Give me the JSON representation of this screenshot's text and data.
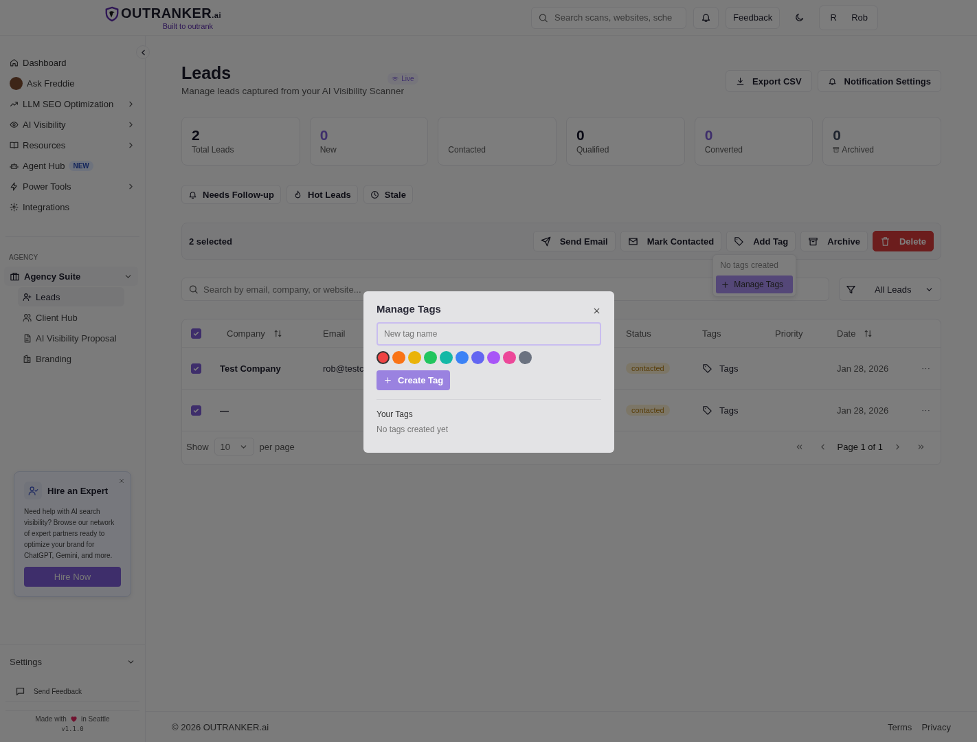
{
  "header": {
    "logo": {
      "name": "OUTRANKER",
      "suffix": ".ai",
      "tagline": "Built to outrank"
    },
    "search": {
      "placeholder": "Search scans, websites, sche"
    },
    "feedback": "Feedback",
    "user": {
      "initial": "R",
      "name": "Rob"
    }
  },
  "sidebar": {
    "nav": [
      {
        "label": "Dashboard",
        "chevron": false
      },
      {
        "label": "Ask Freddie",
        "chevron": false
      },
      {
        "label": "LLM SEO Optimization",
        "chevron": true
      },
      {
        "label": "AI Visibility",
        "chevron": true
      },
      {
        "label": "Resources",
        "chevron": true
      },
      {
        "label": "Agent Hub",
        "chevron": false,
        "badge": "NEW"
      },
      {
        "label": "Power Tools",
        "chevron": true
      },
      {
        "label": "Integrations",
        "chevron": false
      }
    ],
    "section_label": "AGENCY",
    "group": {
      "label": "Agency Suite",
      "expanded": true,
      "children": [
        {
          "label": "Leads",
          "selected": true
        },
        {
          "label": "Client Hub",
          "selected": false
        },
        {
          "label": "AI Visibility Proposal",
          "selected": false
        },
        {
          "label": "Branding",
          "selected": false
        }
      ]
    },
    "promo": {
      "title": "Hire an Expert",
      "text": "Need help with AI search visibility? Browse our network of expert partners ready to optimize your brand for ChatGPT, Gemini, and more.",
      "button": "Hire Now"
    },
    "settings": {
      "label": "Settings",
      "expanded": false
    },
    "send_feedback": "Send Feedback",
    "made_with": {
      "before": "Made with",
      "after": "in Seattle",
      "version": "v1.1.0"
    }
  },
  "main": {
    "title": "Leads",
    "live": "Live",
    "subtitle": "Manage leads captured from your AI Visibility Scanner",
    "actions": [
      "Export CSV",
      "Notification Settings"
    ],
    "stats": [
      {
        "value": "2",
        "label": "Total Leads",
        "kind": "dark"
      },
      {
        "value": "0",
        "label": "New",
        "kind": "accent"
      },
      {
        "label": "Contacted"
      },
      {
        "value": "0",
        "label": "Qualified",
        "kind": "dark"
      },
      {
        "value": "0",
        "label": "Converted",
        "kind": "accent"
      },
      {
        "value": "0",
        "label": "Archived",
        "kind": "muted"
      }
    ],
    "quick_filters": [
      "Needs Follow-up",
      "Hot Leads",
      "Stale"
    ],
    "bulk_bar": {
      "count": "2 selected",
      "actions": [
        {
          "label": "Send Email",
          "kind": "plain"
        },
        {
          "label": "Mark Contacted",
          "kind": "plain"
        },
        {
          "label": "Add Tag",
          "kind": "plain"
        },
        {
          "label": "Archive",
          "kind": "plain"
        },
        {
          "label": "Delete",
          "kind": "danger"
        }
      ]
    },
    "tag_menu": {
      "empty": "No tags created",
      "button": "Manage Tags"
    },
    "search": {
      "placeholder": "Search by email, company, or website..."
    },
    "filter": "All Leads",
    "table": {
      "all_selected": true,
      "columns": [
        {
          "label": "Company",
          "sortable": true
        },
        {
          "label": "Email",
          "sortable": false
        },
        {
          "label": "Status",
          "sortable": false
        },
        {
          "label": "Tags",
          "sortable": false
        },
        {
          "label": "Priority",
          "sortable": false
        },
        {
          "label": "Date",
          "sortable": true
        }
      ],
      "rows": [
        {
          "selected": true,
          "company": "Test Company",
          "email": "rob@testc",
          "status": "contacted",
          "tags": "Tags",
          "date": "Jan 28, 2026"
        },
        {
          "selected": true,
          "company": "—",
          "status": "contacted",
          "tags": "Tags",
          "date": "Jan 28, 2026"
        }
      ]
    },
    "pagination": {
      "show": "Show",
      "per_page": "10",
      "per_page_label": "per page",
      "page": "Page 1 of 1"
    }
  },
  "modal": {
    "title": "Manage Tags",
    "placeholder": "New tag name",
    "colors": [
      {
        "color": "#ef4444",
        "selected": true
      },
      {
        "color": "#f97316",
        "selected": false
      },
      {
        "color": "#eab308",
        "selected": false
      },
      {
        "color": "#22c55e",
        "selected": false
      },
      {
        "color": "#14b8a6",
        "selected": false
      },
      {
        "color": "#3b82f6",
        "selected": false
      },
      {
        "color": "#6366f1",
        "selected": false
      },
      {
        "color": "#a855f7",
        "selected": false
      },
      {
        "color": "#ec4899",
        "selected": false
      },
      {
        "color": "#6b7280",
        "selected": false
      }
    ],
    "create": "Create Tag",
    "create_disabled": true,
    "section": "Your Tags",
    "empty": "No tags created yet"
  },
  "footer": {
    "copyright": "© 2026 OUTRANKER.ai",
    "links": [
      "Terms",
      "Privacy"
    ]
  }
}
